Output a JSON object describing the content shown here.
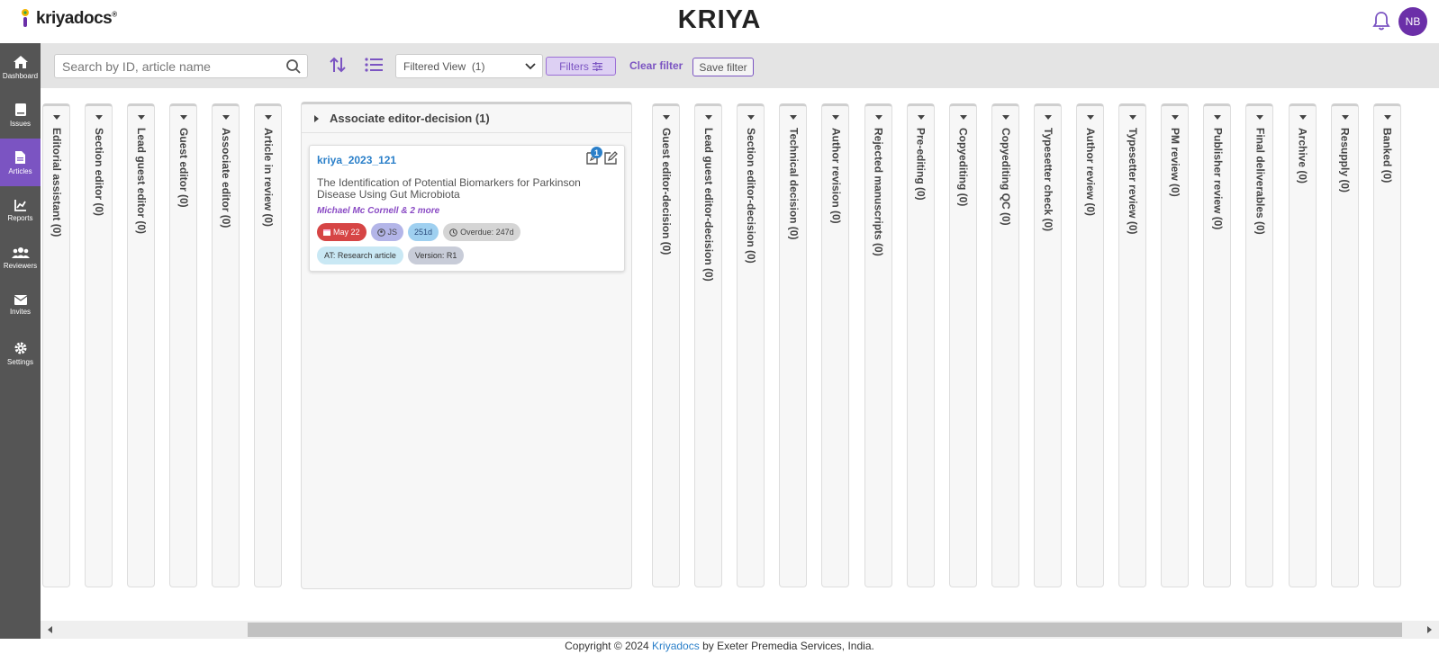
{
  "header": {
    "logo_text": "kriyadocs",
    "logo_mark": "®",
    "title": "KRIYA",
    "avatar_initials": "NB",
    "icons": [
      "bell-icon"
    ]
  },
  "sidebar": {
    "items": [
      {
        "label": "Dashboard",
        "icon": "home-icon"
      },
      {
        "label": "Issues",
        "icon": "book-icon"
      },
      {
        "label": "Articles",
        "icon": "document-icon",
        "active": true
      },
      {
        "label": "Reports",
        "icon": "chart-icon"
      },
      {
        "label": "Reviewers",
        "icon": "users-icon"
      },
      {
        "label": "Invites",
        "icon": "envelope-icon"
      },
      {
        "label": "Settings",
        "icon": "gear-icon"
      }
    ]
  },
  "toolbar": {
    "search_placeholder": "Search by ID, article name",
    "view_label": "Filtered View",
    "view_count": "(1)",
    "filters_label": "Filters",
    "clear_filter_label": "Clear filter",
    "save_filter_label": "Save filter"
  },
  "columns_before": [
    "Editorial assistant (0)",
    "Section editor (0)",
    "Lead guest editor (0)",
    "Guest editor (0)",
    "Associate editor (0)",
    "Article in review (0)"
  ],
  "expanded_column": {
    "title": "Associate editor-decision (1)",
    "card": {
      "id": "kriya_2023_121",
      "notes_count": "1",
      "title": "The Identification of Potential Biomarkers for Parkinson Disease Using Gut Microbiota",
      "authors": "Michael Mc Cornell & 2 more",
      "date_chip": "May 22",
      "assignee_chip": "JS",
      "days_chip": "251d",
      "overdue_chip": "Overdue: 247d",
      "type_chip": "AT: Research article",
      "version_chip": "Version: R1"
    }
  },
  "columns_after": [
    "Guest editor-decision (0)",
    "Lead guest editor-decision (0)",
    "Section editor-decision (0)",
    "Technical decision (0)",
    "Author revision (0)",
    "Rejected manuscripts (0)",
    "Pre-editing (0)",
    "Copyediting (0)",
    "Copyediting QC (0)",
    "Typesetter check (0)",
    "Author review (0)",
    "Typesetter review (0)",
    "PM review (0)",
    "Publisher review (0)",
    "Final deliverables (0)",
    "Archive (0)",
    "Resupply (0)",
    "Banked (0)"
  ],
  "footer": {
    "prefix": "Copyright © 2024",
    "link": "Kriyadocs",
    "suffix": "by Exeter Premedia Services, India."
  },
  "colors": {
    "accent": "#7b54c2",
    "sidebar": "#555555",
    "link": "#2a7fc9",
    "avatar": "#6b2fa8"
  }
}
